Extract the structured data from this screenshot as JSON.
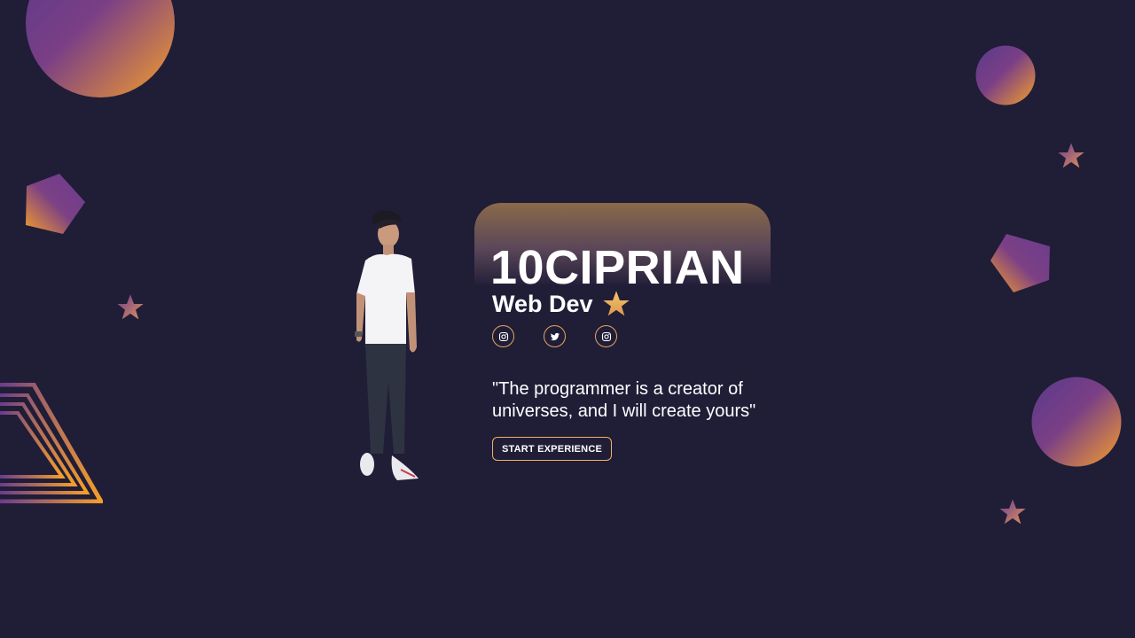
{
  "hero": {
    "name": "10CIPRIAN",
    "role": "Web Dev",
    "quote": "\"The programmer is a creator of universes, and I will create yours\"",
    "cta_label": "START EXPERIENCE"
  },
  "socials": [
    {
      "icon": "instagram-icon"
    },
    {
      "icon": "twitter-icon"
    },
    {
      "icon": "instagram-icon"
    }
  ],
  "colors": {
    "background": "#201d37",
    "gradient_purple": "#6e3f8c",
    "gradient_orange": "#f59e2a",
    "accent": "#e6a55e",
    "text": "#ffffff"
  }
}
